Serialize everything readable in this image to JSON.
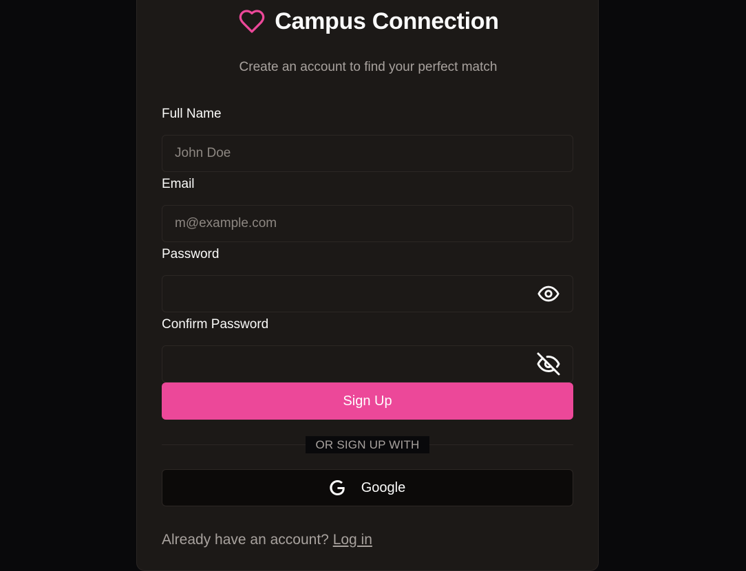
{
  "header": {
    "title": "Campus Connection",
    "subtitle": "Create an account to find your perfect match",
    "logo_icon": "heart-icon",
    "accent_color": "#ec4899"
  },
  "form": {
    "full_name": {
      "label": "Full Name",
      "placeholder": "John Doe",
      "value": ""
    },
    "email": {
      "label": "Email",
      "placeholder": "m@example.com",
      "value": ""
    },
    "password": {
      "label": "Password",
      "value": "",
      "toggle_icon": "eye-icon"
    },
    "confirm_password": {
      "label": "Confirm Password",
      "value": "",
      "toggle_icon": "eye-off-icon"
    }
  },
  "actions": {
    "signup_label": "Sign Up",
    "divider_text": "OR SIGN UP WITH",
    "google_label": "Google",
    "google_icon": "google-icon"
  },
  "footer": {
    "prompt": "Already have an account?",
    "login_label": "Log in"
  }
}
